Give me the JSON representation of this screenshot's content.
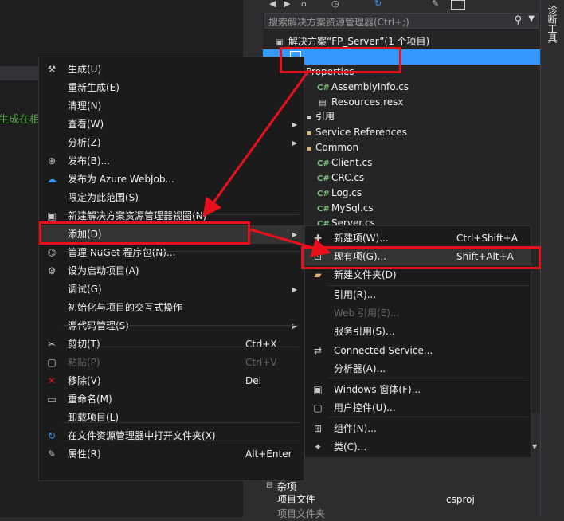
{
  "editor": {
    "partial_text": "生成在相"
  },
  "solution_explorer": {
    "search_placeholder": "搜索解决方案资源管理器(Ctrl+;)",
    "solution_label": "解决方案“FP_Server”(1 个项目)",
    "tree": [
      {
        "label": "Properties"
      },
      {
        "label": "AssemblyInfo.cs",
        "icon": "C#"
      },
      {
        "label": "Resources.resx"
      },
      {
        "label": "引用"
      },
      {
        "label": "Service References"
      },
      {
        "label": "Common"
      },
      {
        "label": "Client.cs",
        "icon": "C#"
      },
      {
        "label": "CRC.cs",
        "icon": "C#"
      },
      {
        "label": "Log.cs",
        "icon": "C#"
      },
      {
        "label": "MySql.cs",
        "icon": "C#"
      },
      {
        "label": "Server.cs",
        "icon": "C#"
      }
    ],
    "props_section": "杂项",
    "props_rows": [
      {
        "name": "项目文件",
        "value": "csproj"
      },
      {
        "name": "项目文件夹",
        "value": ""
      }
    ]
  },
  "side_tab": {
    "label": "诊断工具"
  },
  "context_menu": {
    "items": [
      {
        "label": "生成(U)",
        "icon": "build-icon"
      },
      {
        "label": "重新生成(E)"
      },
      {
        "label": "清理(N)"
      },
      {
        "label": "查看(W)",
        "submenu": true
      },
      {
        "label": "分析(Z)",
        "submenu": true
      },
      {
        "label": "发布(B)...",
        "icon": "globe-icon"
      },
      {
        "label": "发布为 Azure WebJob...",
        "icon": "cloud-icon"
      },
      {
        "label": "限定为此范围(S)"
      },
      {
        "label": "新建解决方案资源管理器视图(N)",
        "icon": "window-icon"
      },
      {
        "label": "添加(D)",
        "submenu": true,
        "highlighted": true
      },
      {
        "label": "管理 NuGet 程序包(N)...",
        "icon": "nuget-icon"
      },
      {
        "label": "设为启动项目(A)",
        "icon": "gear-icon"
      },
      {
        "label": "调试(G)",
        "submenu": true
      },
      {
        "label": "初始化与项目的交互式操作"
      },
      {
        "label": "源代码管理(S)",
        "submenu": true
      },
      {
        "label": "剪切(T)",
        "shortcut": "Ctrl+X",
        "icon": "scissors-icon"
      },
      {
        "label": "粘贴(P)",
        "shortcut": "Ctrl+V",
        "disabled": true,
        "icon": "paste-icon"
      },
      {
        "label": "移除(V)",
        "shortcut": "Del",
        "icon": "remove-icon"
      },
      {
        "label": "重命名(M)",
        "icon": "rename-icon"
      },
      {
        "label": "卸载项目(L)"
      },
      {
        "label": "在文件资源管理器中打开文件夹(X)",
        "icon": "refresh-icon"
      },
      {
        "label": "属性(R)",
        "shortcut": "Alt+Enter",
        "icon": "wrench-icon"
      }
    ]
  },
  "add_submenu": {
    "items": [
      {
        "label": "新建项(W)...",
        "shortcut": "Ctrl+Shift+A",
        "icon": "new-item-icon"
      },
      {
        "label": "现有项(G)...",
        "shortcut": "Shift+Alt+A",
        "icon": "existing-item-icon",
        "highlighted": true
      },
      {
        "label": "新建文件夹(D)",
        "icon": "new-folder-icon"
      },
      {
        "label": "引用(R)..."
      },
      {
        "label": "Web 引用(E)...",
        "disabled": true
      },
      {
        "label": "服务引用(S)..."
      },
      {
        "label": "Connected Service...",
        "icon": "connected-service-icon"
      },
      {
        "label": "分析器(A)..."
      },
      {
        "label": "Windows 窗体(F)...",
        "icon": "windows-form-icon"
      },
      {
        "label": "用户控件(U)...",
        "icon": "user-control-icon"
      },
      {
        "label": "组件(N)...",
        "icon": "component-icon"
      },
      {
        "label": "类(C)...",
        "icon": "class-icon"
      }
    ]
  },
  "colors": {
    "annotation_red": "#e8111b",
    "selection_blue": "#3399ff"
  }
}
